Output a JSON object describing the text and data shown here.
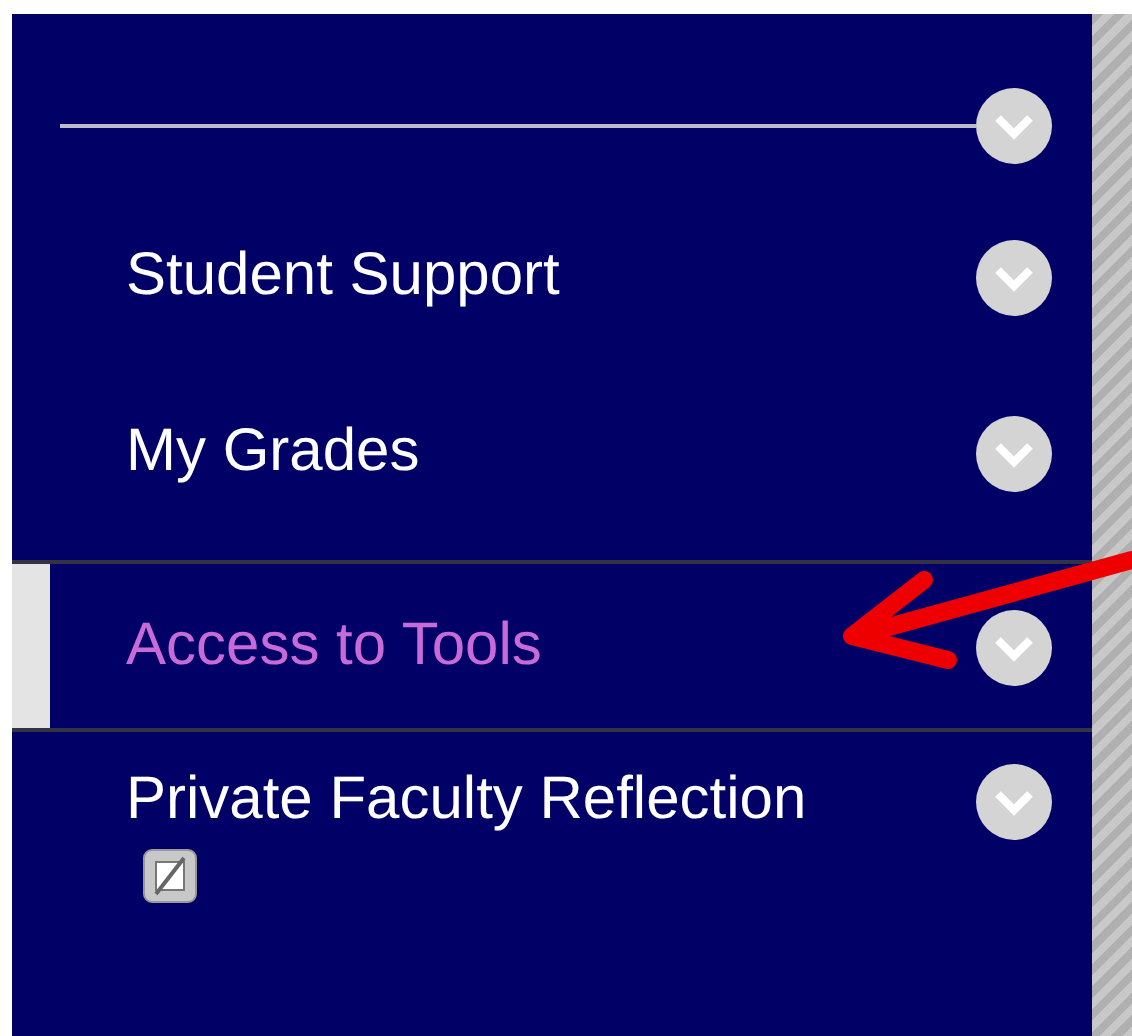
{
  "menu": {
    "items": [
      {
        "label": "Student Support",
        "selected": false,
        "hidden": false
      },
      {
        "label": "My Grades",
        "selected": false,
        "hidden": false
      },
      {
        "label": "Access to Tools",
        "selected": true,
        "hidden": false
      },
      {
        "label": "Private Faculty Reflection",
        "selected": false,
        "hidden": true
      }
    ]
  }
}
